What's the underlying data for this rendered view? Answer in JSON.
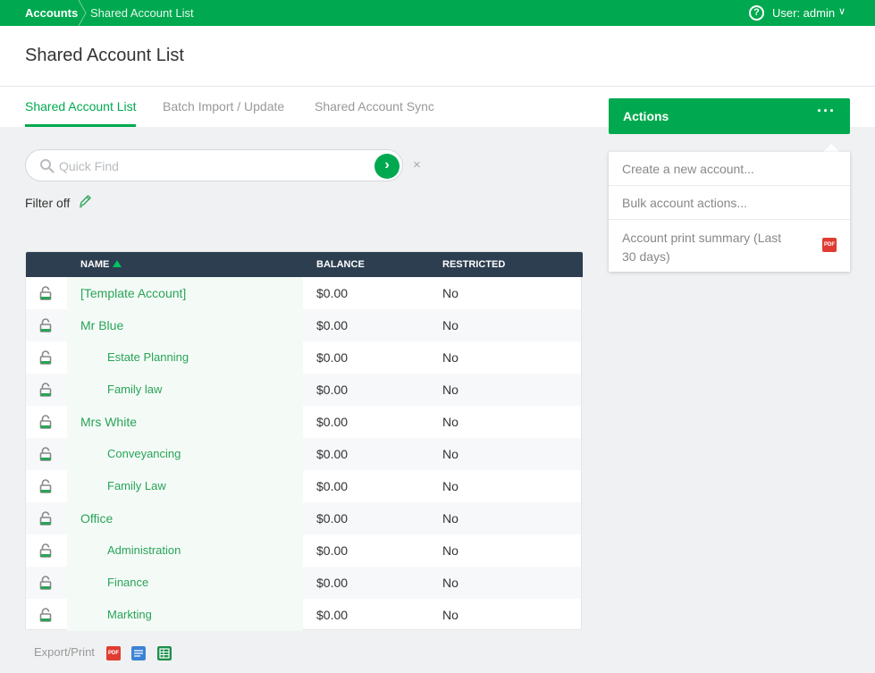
{
  "topbar": {
    "breadcrumb_root": "Accounts",
    "breadcrumb_current": "Shared Account List",
    "help_glyph": "?",
    "user_label": "User: admin",
    "user_chevron": "∨"
  },
  "header": {
    "title": "Shared Account List",
    "tabs": [
      {
        "label": "Shared Account List",
        "active": true
      },
      {
        "label": "Batch Import / Update",
        "active": false
      },
      {
        "label": "Shared Account Sync",
        "active": false
      }
    ]
  },
  "actions": {
    "label": "Actions",
    "more_glyph": "···",
    "menu": [
      {
        "label": "Create a new account..."
      },
      {
        "label": "Bulk account actions..."
      },
      {
        "label": "Account print summary (Last 30 days)",
        "icon": "pdf-icon",
        "icon_text": "PDF"
      }
    ]
  },
  "search": {
    "placeholder": "Quick Find",
    "go_glyph": "›",
    "clear_glyph": "×"
  },
  "filter": {
    "label": "Filter off"
  },
  "table": {
    "columns": {
      "name": "NAME",
      "balance": "BALANCE",
      "restricted": "RESTRICTED"
    },
    "sort_column": "name",
    "rows": [
      {
        "name": "[Template Account]",
        "balance": "$0.00",
        "restricted": "No",
        "child": false
      },
      {
        "name": "Mr Blue",
        "balance": "$0.00",
        "restricted": "No",
        "child": false
      },
      {
        "name": "Estate Planning",
        "balance": "$0.00",
        "restricted": "No",
        "child": true
      },
      {
        "name": "Family law",
        "balance": "$0.00",
        "restricted": "No",
        "child": true
      },
      {
        "name": "Mrs White",
        "balance": "$0.00",
        "restricted": "No",
        "child": false
      },
      {
        "name": "Conveyancing",
        "balance": "$0.00",
        "restricted": "No",
        "child": true
      },
      {
        "name": "Family Law",
        "balance": "$0.00",
        "restricted": "No",
        "child": true
      },
      {
        "name": "Office",
        "balance": "$0.00",
        "restricted": "No",
        "child": false
      },
      {
        "name": "Administration",
        "balance": "$0.00",
        "restricted": "No",
        "child": true
      },
      {
        "name": "Finance",
        "balance": "$0.00",
        "restricted": "No",
        "child": true
      },
      {
        "name": "Markting",
        "balance": "$0.00",
        "restricted": "No",
        "child": true
      }
    ]
  },
  "export": {
    "label": "Export/Print",
    "icons": [
      {
        "name": "pdf-icon",
        "text": "PDF",
        "color": "#e03c31"
      },
      {
        "name": "csv-icon",
        "text": "",
        "color": "#3b82d6"
      },
      {
        "name": "excel-icon",
        "text": "",
        "color": "#1e8f4e"
      }
    ]
  },
  "colors": {
    "brand_green": "#00a94f",
    "table_header": "#2c3e50",
    "link_green": "#2aa358"
  }
}
